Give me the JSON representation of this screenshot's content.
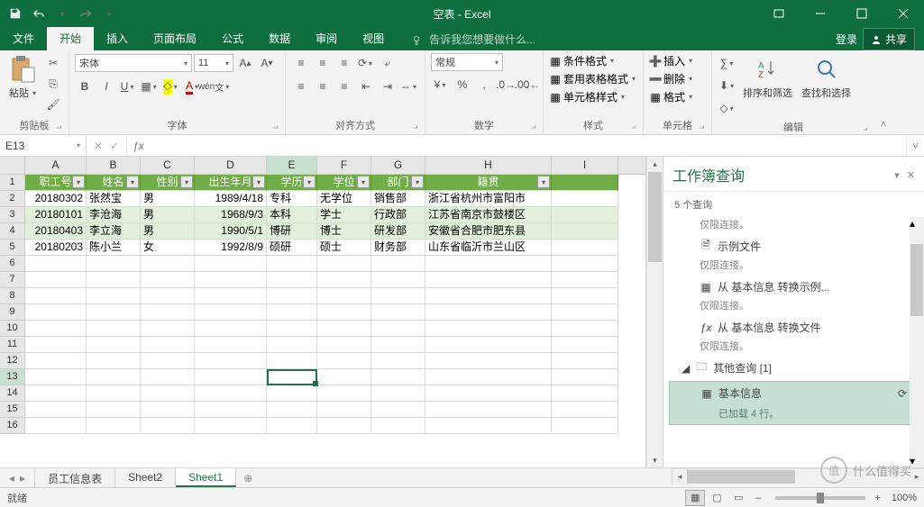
{
  "app": {
    "title": "空表 - Excel"
  },
  "tabs": {
    "file": "文件",
    "home": "开始",
    "insert": "插入",
    "layout": "页面布局",
    "formulas": "公式",
    "data": "数据",
    "review": "审阅",
    "view": "视图",
    "tellme": "告诉我您想要做什么...",
    "login": "登录",
    "share": "共享"
  },
  "ribbon": {
    "clipboard": {
      "label": "剪贴板",
      "paste": "粘贴"
    },
    "font": {
      "label": "字体",
      "name": "宋体",
      "size": "11"
    },
    "align": {
      "label": "对齐方式"
    },
    "number": {
      "label": "数字",
      "format": "常规"
    },
    "styles": {
      "label": "样式",
      "cond": "条件格式",
      "table": "套用表格格式",
      "cell": "单元格样式"
    },
    "cells": {
      "label": "单元格",
      "insert": "插入",
      "delete": "删除",
      "format": "格式"
    },
    "editing": {
      "label": "编辑",
      "sort": "排序和筛选",
      "find": "查找和选择"
    }
  },
  "namebox": "E13",
  "columns": [
    "A",
    "B",
    "C",
    "D",
    "E",
    "F",
    "G",
    "H",
    "I"
  ],
  "headers": [
    "职工号",
    "姓名",
    "性别",
    "出生年月",
    "学历",
    "学位",
    "部门",
    "籍贯"
  ],
  "rows": [
    {
      "id": "20180302",
      "name": "张然宝",
      "sex": "男",
      "dob": "1989/4/18",
      "edu": "专科",
      "deg": "无学位",
      "dept": "销售部",
      "origin": "浙江省杭州市富阳市"
    },
    {
      "id": "20180101",
      "name": "李沧海",
      "sex": "男",
      "dob": "1968/9/3",
      "edu": "本科",
      "deg": "学士",
      "dept": "行政部",
      "origin": "江苏省南京市鼓楼区"
    },
    {
      "id": "20180403",
      "name": "李立海",
      "sex": "男",
      "dob": "1990/5/1",
      "edu": "博研",
      "deg": "博士",
      "dept": "研发部",
      "origin": "安徽省合肥市肥东县"
    },
    {
      "id": "20180203",
      "name": "陈小兰",
      "sex": "女",
      "dob": "1992/8/9",
      "edu": "硕研",
      "deg": "硕士",
      "dept": "财务部",
      "origin": "山东省临沂市兰山区"
    }
  ],
  "sheets": {
    "s1": "员工信息表",
    "s2": "Sheet2",
    "s3": "Sheet1"
  },
  "queries": {
    "pane_title": "工作簿查询",
    "count": "5 个查询",
    "conn_only": "仅限连接。",
    "item_example": "示例文件",
    "item_convert_example": "从 基本信息 转换示例...",
    "item_convert_file": "从 基本信息 转换文件",
    "group_other": "其他查询 [1]",
    "item_basic": "基本信息",
    "loaded": "已加载 4 行。"
  },
  "status": {
    "ready": "就绪",
    "zoom": "100%"
  },
  "watermark": {
    "char": "值",
    "text": "什么值得买"
  }
}
